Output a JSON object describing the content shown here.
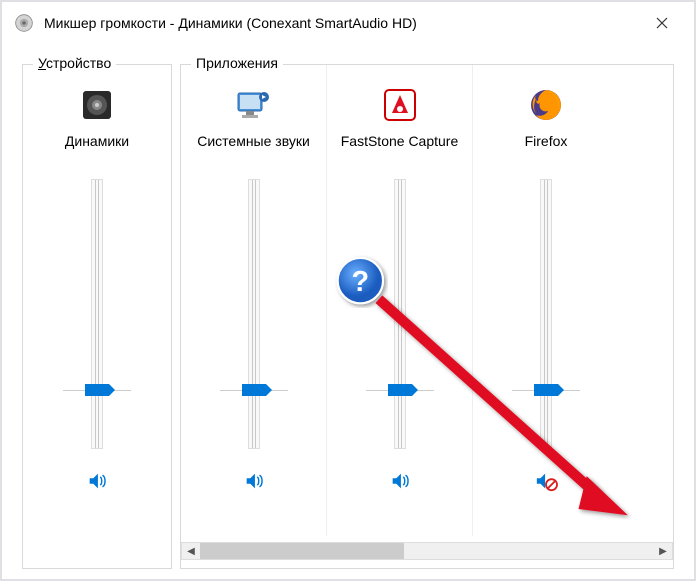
{
  "window": {
    "title": "Микшер громкости - Динамики (Conexant SmartAudio HD)"
  },
  "device_section": {
    "label": "Устройство",
    "channel": {
      "name": "Динамики",
      "volume": 22,
      "muted": false,
      "icon": "speaker-device"
    }
  },
  "apps_section": {
    "label": "Приложения",
    "channels": [
      {
        "name": "Системные звуки",
        "volume": 22,
        "muted": false,
        "icon": "system-sounds"
      },
      {
        "name": "FastStone Capture",
        "volume": 22,
        "muted": false,
        "icon": "faststone"
      },
      {
        "name": "Firefox",
        "volume": 22,
        "muted": true,
        "icon": "firefox"
      }
    ]
  },
  "annotation": {
    "type": "question-arrow",
    "from": "center",
    "to": "firefox-mute-button"
  }
}
